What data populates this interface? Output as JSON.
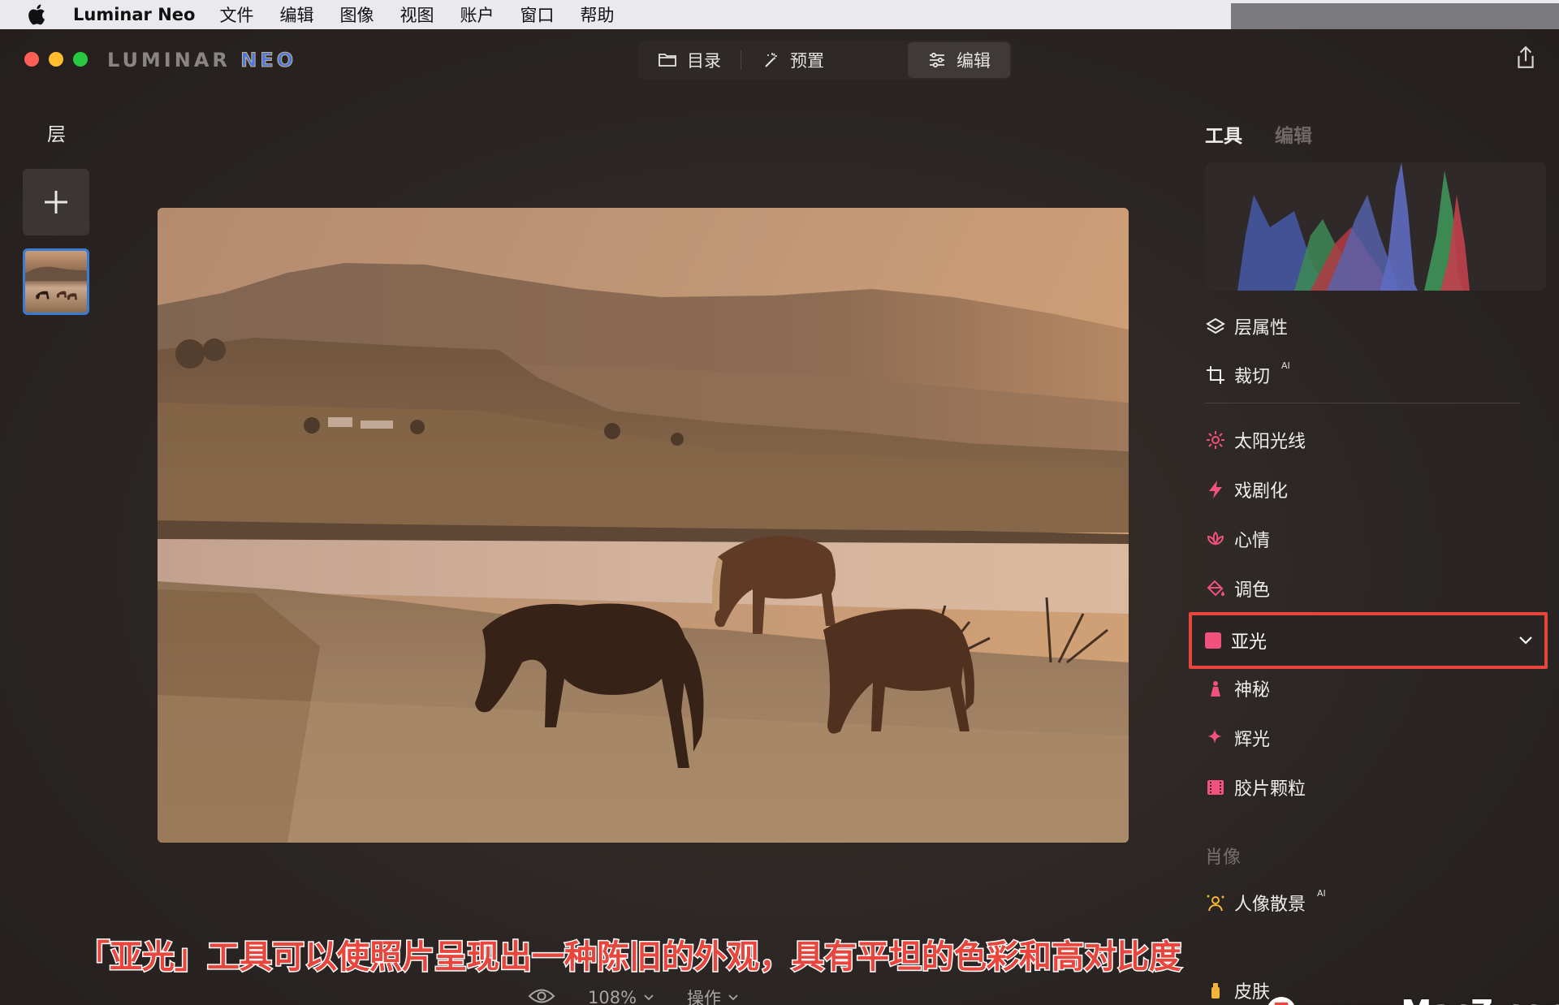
{
  "menubar": {
    "app_name": "Luminar Neo",
    "items": [
      "文件",
      "编辑",
      "图像",
      "视图",
      "账户",
      "窗口",
      "帮助"
    ]
  },
  "window": {
    "logo_left": "LUMINAR",
    "logo_right": "NEO",
    "nav": {
      "catalog": "目录",
      "presets": "预置",
      "edit": "编辑"
    }
  },
  "layers": {
    "title": "层"
  },
  "right_panel": {
    "tabs": {
      "tools": "工具",
      "edits": "编辑"
    },
    "tools": {
      "layer_props": "层属性",
      "crop": "裁切",
      "crop_badge": "AI",
      "sunrays": "太阳光线",
      "dramatic": "戏剧化",
      "mood": "心情",
      "toning": "调色",
      "matte": "亚光",
      "mystical": "神秘",
      "glow": "辉光",
      "film_grain": "胶片颗粒"
    },
    "portrait_section": "肖像",
    "portrait_tools": {
      "portrait_bokeh": "人像散景",
      "portrait_bokeh_badge": "AI",
      "skin": "皮肤"
    },
    "colors": {
      "highlight": "#e8453d",
      "matte_icon": "#f0517d"
    }
  },
  "bottom_bar": {
    "zoom": "108%",
    "actions": "操作"
  },
  "caption": "「亚光」工具可以使照片呈现出一种陈旧的外观，具有平坦的色彩和高对比度",
  "watermark": "www.MacZ.com"
}
